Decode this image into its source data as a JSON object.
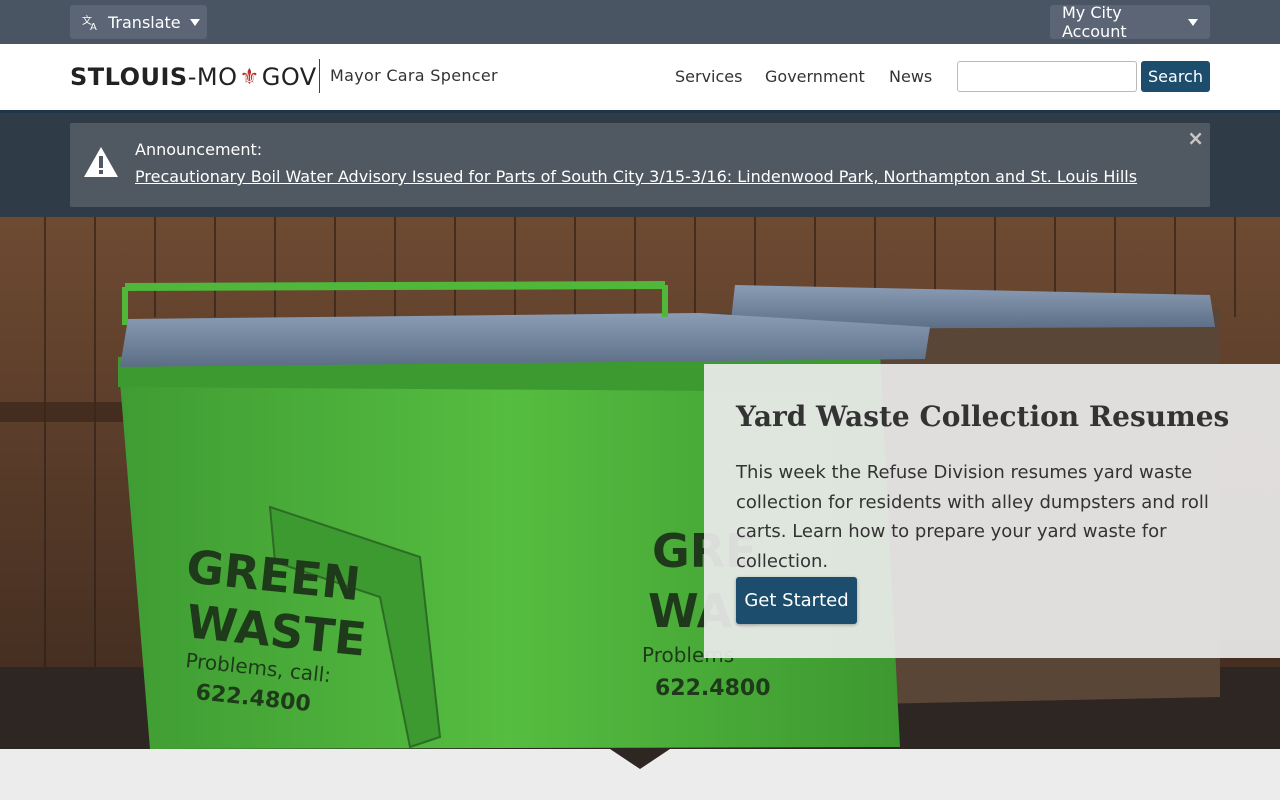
{
  "topbar": {
    "translate_label": "Translate",
    "account_label": "My City Account"
  },
  "header": {
    "logo_part1": "STLOUIS",
    "logo_dash": "-",
    "logo_part2": "MO",
    "logo_fleur": "⚜",
    "logo_part3": "GOV",
    "mayor": "Mayor Cara Spencer",
    "nav": [
      "Services",
      "Government",
      "News"
    ],
    "search_label": "Search",
    "search_value": ""
  },
  "announcement": {
    "label": "Announcement:",
    "link": "Precautionary Boil Water Advisory Issued for Parts of South City 3/15-3/16: Lindenwood Park, Northampton and St. Louis Hills",
    "close": "×"
  },
  "hero": {
    "title": "Yard Waste Collection Resumes",
    "text": "This week the Refuse Division resumes yard waste collection for residents with alley dumpsters and roll carts. Learn how to prepare your yard waste for collection.",
    "button": "Get Started",
    "image_text": {
      "left_line1": "GREEN",
      "left_line2": "WASTE",
      "left_line3": "Problems, call:",
      "left_line4": "622.4800",
      "right_line1": "GRE",
      "right_line2": "WAS",
      "right_line3": "Problems",
      "right_line4": "622.4800"
    }
  },
  "colors": {
    "topbar": "#4a5563",
    "primary": "#1c4d6d",
    "announce_band": "#2f3c48",
    "dumpster_green": "#4fb83b"
  }
}
